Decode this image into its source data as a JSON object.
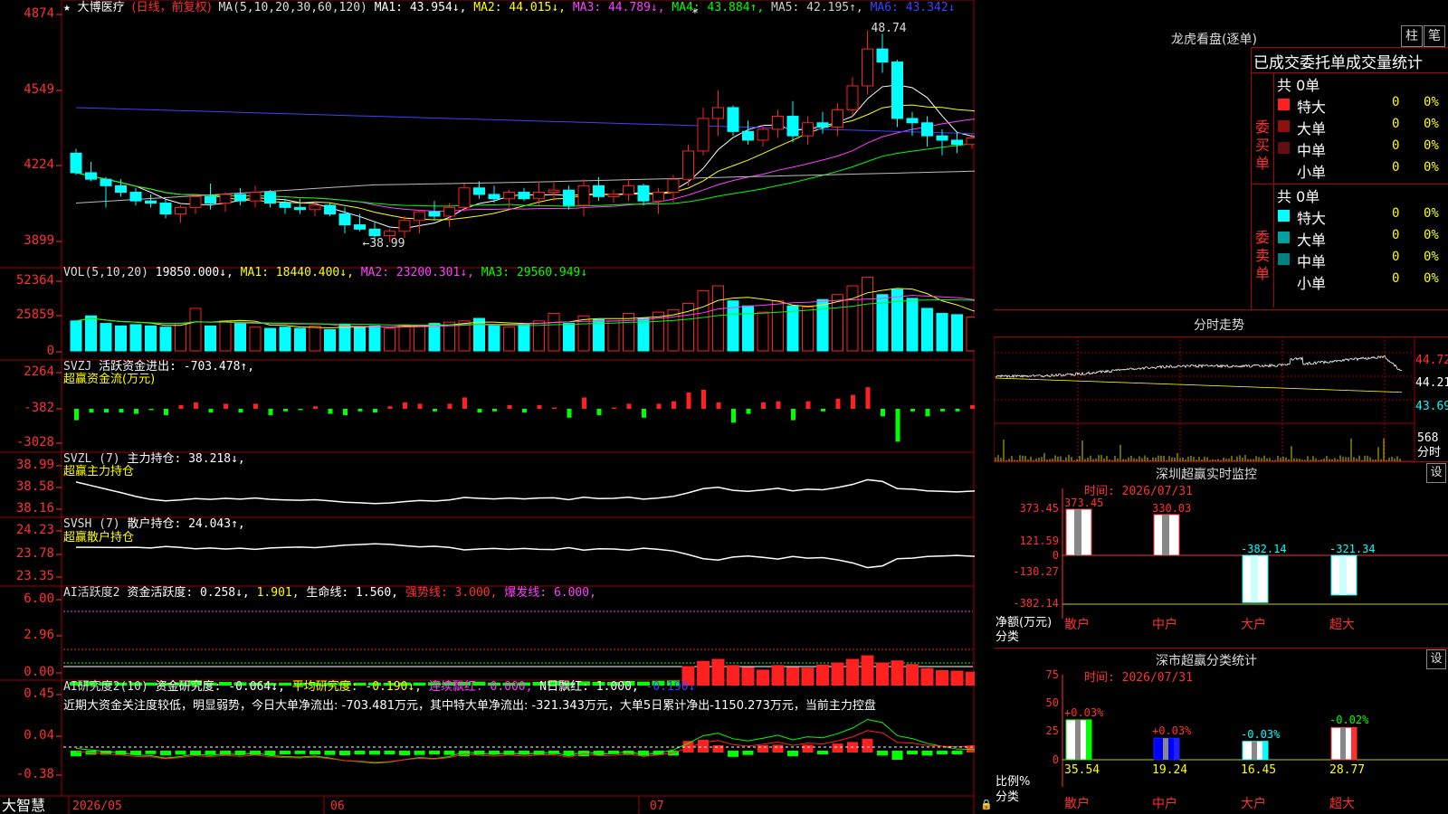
{
  "colors": {
    "up": "#ff2020",
    "down": "#00ffff",
    "frame": "#a00000",
    "axis": "#ff3030"
  },
  "main": {
    "star": "★",
    "stock_name": "大博医疗",
    "period": "(日线，前复权)",
    "ma_params": "MA(5,10,20,30,60,120)",
    "ma1": "MA1: 43.954↓,",
    "ma2": "MA2: 44.015↓,",
    "ma3": "MA3: 44.789↓,",
    "ma4": "MA4: 43.884↑,",
    "ma5": "MA5: 42.195↑,",
    "ma6": "MA6: 43.342↓",
    "y_labels": [
      "4874",
      "4549",
      "4224",
      "3899"
    ],
    "high_marker": "48.74",
    "low_marker": "←38.99",
    "asterisk": "*"
  },
  "vol": {
    "title": "VOL(5,10,20)",
    "value": "19850.000↓,",
    "ma1": "MA1: 18440.400↓,",
    "ma2": "MA2: 23200.301↓,",
    "ma3": "MA3: 29560.949↓",
    "y_labels": [
      "52364",
      "25859",
      "0"
    ]
  },
  "svzj": {
    "title": "SVZJ",
    "label": "活跃资金进出: -703.478↑,",
    "sub": "超赢资金流(万元)",
    "y_labels": [
      "2264",
      "-382",
      "-3028"
    ]
  },
  "svzl": {
    "title": "SVZL (7)",
    "label": "主力持仓: 38.218↓,",
    "sub": "超赢主力持仓",
    "y_labels": [
      "38.99",
      "38.58",
      "38.16"
    ]
  },
  "svsh": {
    "title": "SVSH (7)",
    "label": "散户持仓: 24.043↑,",
    "sub": "超赢散户持仓",
    "y_labels": [
      "24.23",
      "23.78",
      "23.35"
    ]
  },
  "ai_act": {
    "title": "AI活跃度2",
    "label": "资金活跃度: 0.258↓,",
    "v2": "1.901,",
    "life": "生命线: 1.560,",
    "strong": "强势线: 3.000,",
    "burst": "爆发线: 6.000,",
    "y_labels": [
      "6.00",
      "2.96",
      "0.00"
    ]
  },
  "ai_res": {
    "title": "AI研究度2(10)",
    "label": "资金研究度: -0.064↓,",
    "avg": "平均研究度: -0.190↓,",
    "lianxu": "连续飘红: 0.000,",
    "nday": "N日飘红: 1.000,",
    "last": "-0.190↓",
    "comment": "近期大资金关注度较低，明显弱势，今日大单净流出: -703.481万元，其中特大单净流出: -321.343万元，大单5日累计净出-1150.273万元，当前主力控盘",
    "y_labels": [
      "0.45",
      "0.04",
      "-0.38"
    ]
  },
  "xaxis": {
    "brand": "大智慧",
    "dates": [
      "2026/05",
      "06",
      "07"
    ]
  },
  "right": {
    "lhb_title": "龙虎看盘(逐单)",
    "btn_zhu": "柱",
    "btn_bi": "笔",
    "table_header": "已成交委托单成交量统计",
    "buy_label": "委买单",
    "sell_label": "委卖单",
    "buy_total": "共 0单",
    "sell_total": "共 0单",
    "buy_rows": [
      {
        "name": "特大",
        "count": "0",
        "pct": "0%",
        "color": "#ff2020"
      },
      {
        "name": "大单",
        "count": "0",
        "pct": "0%",
        "color": "#901010"
      },
      {
        "name": "中单",
        "count": "0",
        "pct": "0%",
        "color": "#601010"
      },
      {
        "name": "小单",
        "count": "0",
        "pct": "0%",
        "color": ""
      }
    ],
    "sell_rows": [
      {
        "name": "特大",
        "count": "0",
        "pct": "0%",
        "color": "#00ffff"
      },
      {
        "name": "大单",
        "count": "0",
        "pct": "0%",
        "color": "#00a0a0"
      },
      {
        "name": "中单",
        "count": "0",
        "pct": "0%",
        "color": "#008080"
      },
      {
        "name": "小单",
        "count": "0",
        "pct": "0%",
        "color": ""
      }
    ],
    "intraday_title": "分时走势",
    "intraday_prices": [
      "44.72",
      "44.21",
      "43.69"
    ],
    "intraday_vol": "568",
    "intraday_unit": "分时",
    "sz_title": "深圳超赢实时监控",
    "sz_btn": "设",
    "sz_time": "时间: 2026/07/31",
    "sz_y": [
      "373.45",
      "121.59",
      "0",
      "-130.27",
      "-382.14"
    ],
    "sz_values": [
      "373.45",
      "330.03",
      "-382.14",
      "-321.34"
    ],
    "sz_axis_label": "净额(万元)",
    "sz_cat_label": "分类",
    "categories": [
      "散户",
      "中户",
      "大户",
      "超大"
    ],
    "cls_title": "深市超赢分类统计",
    "cls_btn": "设",
    "cls_time": "时间: 2026/07/31",
    "cls_y": [
      "75",
      "50",
      "25",
      "0"
    ],
    "cls_changes": [
      "+0.03%",
      "+0.03%",
      "-0.03%",
      "-0.02%"
    ],
    "cls_values": [
      "35.54",
      "19.24",
      "16.45",
      "28.77"
    ],
    "cls_axis_label": "比例%",
    "cls_cat_label": "分类"
  },
  "chart_data": {
    "type": "candlestick",
    "xlabel": "",
    "ylabel": "",
    "dates_axis": [
      "2026/05",
      "06",
      "07"
    ],
    "ohlc": [
      [
        43.1,
        43.3,
        42.1,
        42.2
      ],
      [
        42.2,
        42.7,
        41.8,
        41.9
      ],
      [
        41.9,
        42.0,
        40.6,
        41.6
      ],
      [
        41.6,
        41.9,
        41.1,
        41.3
      ],
      [
        41.3,
        41.5,
        40.7,
        40.9
      ],
      [
        40.9,
        41.2,
        40.6,
        40.8
      ],
      [
        40.8,
        41.0,
        40.1,
        40.3
      ],
      [
        40.3,
        40.7,
        39.9,
        40.6
      ],
      [
        40.6,
        41.2,
        40.3,
        41.1
      ],
      [
        41.1,
        41.7,
        40.5,
        40.8
      ],
      [
        40.8,
        41.3,
        40.4,
        41.2
      ],
      [
        41.2,
        41.5,
        40.7,
        40.9
      ],
      [
        40.9,
        41.6,
        40.6,
        41.3
      ],
      [
        41.3,
        41.4,
        40.6,
        40.8
      ],
      [
        40.8,
        41.0,
        40.3,
        40.6
      ],
      [
        40.6,
        41.0,
        40.3,
        40.5
      ],
      [
        40.5,
        40.9,
        40.2,
        40.7
      ],
      [
        40.7,
        40.8,
        40.2,
        40.3
      ],
      [
        40.3,
        40.6,
        39.4,
        39.8
      ],
      [
        39.8,
        40.3,
        39.5,
        39.6
      ],
      [
        39.6,
        39.9,
        39.0,
        39.3
      ],
      [
        39.3,
        39.6,
        38.99,
        39.5
      ],
      [
        39.5,
        40.2,
        39.2,
        40.0
      ],
      [
        40.0,
        40.5,
        39.4,
        40.4
      ],
      [
        40.4,
        40.9,
        40.0,
        40.2
      ],
      [
        40.2,
        40.8,
        39.7,
        40.6
      ],
      [
        40.6,
        41.7,
        40.4,
        41.5
      ],
      [
        41.5,
        41.8,
        41.0,
        41.2
      ],
      [
        41.2,
        41.6,
        40.8,
        41.0
      ],
      [
        41.0,
        41.4,
        40.6,
        41.3
      ],
      [
        41.3,
        41.5,
        40.9,
        41.0
      ],
      [
        41.0,
        41.8,
        40.7,
        41.3
      ],
      [
        41.3,
        41.8,
        40.9,
        41.4
      ],
      [
        41.4,
        41.6,
        40.5,
        40.7
      ],
      [
        40.7,
        41.9,
        40.2,
        41.6
      ],
      [
        41.6,
        42.0,
        40.9,
        41.1
      ],
      [
        41.1,
        41.4,
        40.8,
        41.2
      ],
      [
        41.2,
        41.9,
        40.9,
        41.6
      ],
      [
        41.6,
        41.7,
        40.7,
        40.9
      ],
      [
        40.9,
        41.5,
        40.3,
        41.3
      ],
      [
        41.3,
        42.1,
        40.8,
        41.9
      ],
      [
        41.9,
        43.5,
        41.6,
        43.2
      ],
      [
        43.2,
        45.2,
        43.0,
        44.7
      ],
      [
        44.7,
        46.0,
        43.9,
        45.2
      ],
      [
        45.2,
        45.3,
        43.9,
        44.1
      ],
      [
        44.1,
        44.6,
        43.5,
        43.7
      ],
      [
        43.7,
        44.4,
        43.4,
        44.2
      ],
      [
        44.2,
        45.1,
        43.8,
        44.8
      ],
      [
        44.8,
        45.5,
        43.6,
        43.9
      ],
      [
        43.9,
        44.8,
        43.5,
        44.5
      ],
      [
        44.5,
        45.0,
        44.0,
        44.3
      ],
      [
        44.3,
        45.4,
        43.9,
        45.1
      ],
      [
        45.1,
        46.6,
        44.8,
        46.2
      ],
      [
        46.2,
        48.74,
        45.8,
        47.9
      ],
      [
        47.9,
        48.6,
        46.8,
        47.3
      ],
      [
        47.3,
        47.4,
        44.3,
        44.7
      ],
      [
        44.7,
        45.0,
        43.9,
        44.5
      ],
      [
        44.5,
        44.8,
        43.4,
        43.9
      ],
      [
        43.9,
        44.2,
        43.0,
        43.7
      ],
      [
        43.7,
        44.1,
        43.1,
        43.5
      ],
      [
        43.5,
        44.0,
        43.3,
        43.8
      ],
      [
        43.8,
        44.2,
        43.6,
        44.0
      ],
      [
        44.0,
        44.4,
        43.6,
        43.8
      ],
      [
        43.8,
        44.3,
        43.5,
        44.1
      ],
      [
        44.1,
        44.4,
        43.7,
        43.8
      ],
      [
        43.8,
        44.2,
        43.4,
        43.2
      ]
    ],
    "volume": [
      24000,
      28000,
      22000,
      20000,
      21000,
      20000,
      19000,
      22000,
      34000,
      20000,
      24000,
      22000,
      19000,
      18000,
      19000,
      18000,
      20000,
      17000,
      21000,
      19000,
      20000,
      18000,
      21000,
      20000,
      22000,
      23000,
      24000,
      26000,
      20000,
      19000,
      21000,
      24000,
      30000,
      22000,
      28000,
      25000,
      24000,
      30000,
      26000,
      31000,
      33000,
      38000,
      48000,
      52000,
      40000,
      36000,
      31000,
      40000,
      36000,
      35000,
      41000,
      45000,
      52000,
      59000,
      45000,
      49000,
      42000,
      34000,
      30000,
      29000,
      27000,
      26000,
      20000,
      25000,
      24000,
      22000
    ],
    "series": [
      {
        "name": "MA1",
        "last": 43.954
      },
      {
        "name": "MA2",
        "last": 44.015
      },
      {
        "name": "MA3",
        "last": 44.789
      },
      {
        "name": "MA4",
        "last": 43.884
      },
      {
        "name": "MA5",
        "last": 42.195
      },
      {
        "name": "MA6",
        "last": 43.342
      }
    ],
    "ylim": [
      38.99,
      48.74
    ]
  }
}
